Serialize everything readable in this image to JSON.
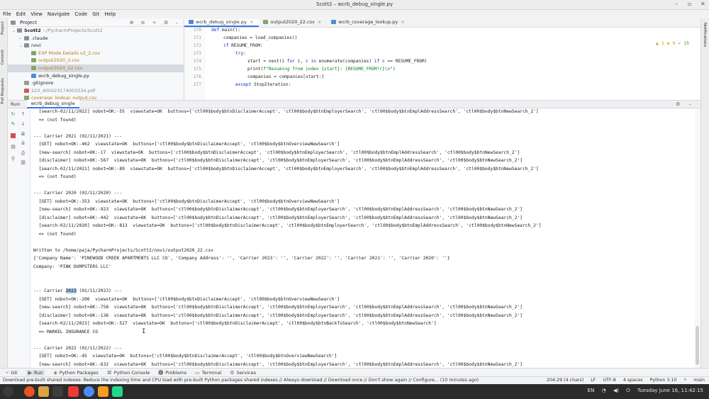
{
  "window": {
    "title": "Scott2 – wcrb_debug_single.py",
    "controls": [
      "–",
      "▫",
      "✕"
    ]
  },
  "menu": [
    "File",
    "Edit",
    "View",
    "Navigate",
    "Code",
    "Git",
    "Help"
  ],
  "left_strip": {
    "labels": [
      "Project",
      "Commit",
      "Pull Requests"
    ]
  },
  "right_strip": {
    "labels": [
      "Notifications"
    ]
  },
  "project": {
    "header": "Project",
    "tools": "⊕ ≡ ÷ ⚙ –",
    "tree": [
      {
        "indent": 0,
        "arrow": "⌄",
        "icon": "fold",
        "name": "Scott2",
        "suffix": " ~/PycharmProjects/Scott2",
        "style": "bold"
      },
      {
        "indent": 1,
        "arrow": "›",
        "icon": "fold",
        "name": ".claude",
        "suffix": "",
        "style": ""
      },
      {
        "indent": 1,
        "arrow": "⌄",
        "icon": "fold",
        "name": "novi",
        "suffix": "",
        "style": ""
      },
      {
        "indent": 2,
        "arrow": "",
        "icon": "csv",
        "name": "EXP Mode Details v2_2.csv",
        "suffix": "",
        "style": "orange"
      },
      {
        "indent": 2,
        "arrow": "",
        "icon": "csv",
        "name": "output2020_2.csv",
        "suffix": "",
        "style": "orange"
      },
      {
        "indent": 2,
        "arrow": "",
        "icon": "csv",
        "name": "output2020_22.csv",
        "suffix": "",
        "style": "orange sel"
      },
      {
        "indent": 2,
        "arrow": "",
        "icon": "py",
        "name": "wcrb_debug_single.py",
        "suffix": "",
        "style": ""
      },
      {
        "indent": 1,
        "arrow": "",
        "icon": "gi",
        "name": ".gitignore",
        "suffix": "",
        "style": ""
      },
      {
        "indent": 1,
        "arrow": "",
        "icon": "pdf",
        "name": "223_400023174003334.pdf",
        "suffix": "",
        "style": "muted"
      },
      {
        "indent": 1,
        "arrow": "",
        "icon": "csv",
        "name": "coverage_lookup_output.csv",
        "suffix": "",
        "style": "orange"
      }
    ]
  },
  "editor": {
    "tabs": [
      {
        "label": "wcrb_debug_single.py",
        "icon": "py",
        "active": true
      },
      {
        "label": "output2020_22.csv",
        "icon": "csv",
        "active": false
      },
      {
        "label": "wcrb_coverage_lookup.py",
        "icon": "py",
        "active": false
      }
    ],
    "inspections": {
      "warnings": "▲ 1",
      "weak": "◈ 9",
      "typos": "✓ 15"
    },
    "lines": [
      {
        "n": "170",
        "indent": 0,
        "html": "<span class='kw'>def</span> main():"
      },
      {
        "n": "171",
        "indent": 1,
        "html": "companies = load_companies()"
      },
      {
        "n": "172",
        "indent": 1,
        "html": "<span class='kw'>if</span> RESUME_FROM:"
      },
      {
        "n": "173",
        "indent": 2,
        "html": "<span class='kw'>try</span>:"
      },
      {
        "n": "174",
        "indent": 3,
        "html": "start = next(i <span class='kw'>for</span> i, c <span class='kw'>in</span> enumerate(companies) <span class='kw'>if</span> c == RESUME_FROM)"
      },
      {
        "n": "175",
        "indent": 3,
        "html": "print(<span class='str'>f\"Resuming from index {start}: {RESUME_FROM!r}\\n\"</span>)"
      },
      {
        "n": "176",
        "indent": 3,
        "html": "companies = companies[start:]"
      },
      {
        "n": "177",
        "indent": 2,
        "html": "<span class='kw'>except</span> StopIteration:"
      }
    ]
  },
  "run": {
    "label": "Run:",
    "tab": "wcrb_debug_single",
    "console": [
      "  [search-02/11/2022] nobot=OK:-55  viewstate=OK  buttons=['ctl00$body$btnDisclaimerAccept', 'ctl00$body$btnEmployerSearch', 'ctl00$body$btnEmplAddressSearch', 'ctl00$body$btnNewSearch_2']",
      "  => (not found)",
      "",
      "--- Carrier 2021 (02/11/2021) ---",
      "  [GET] nobot=OK:-462  viewstate=OK  buttons=['ctl00$body$btnDisclaimerAccept', 'ctl00$body$btnOverviewNewSearch']",
      "  [new-search] nobot=OK:-17  viewstate=OK  buttons=['ctl00$body$btnDisclaimerAccept', 'ctl00$body$btnEmployerSearch', 'ctl00$body$btnEmplAddressSearch', 'ctl00$body$btnNewSearch_2']",
      "  [disclaimer] nobot=OK:-567  viewstate=OK  buttons=['ctl00$body$btnDisclaimerAccept', 'ctl00$body$btnEmployerSearch', 'ctl00$body$btnEmplAddressSearch', 'ctl00$body$btnNewSearch_2']",
      "  [search-02/11/2021] nobot=OK:-89  viewstate=OK  buttons=['ctl00$body$btnDisclaimerAccept', 'ctl00$body$btnEmployerSearch', 'ctl00$body$btnEmplAddressSearch', 'ctl00$body$btnNewSearch_2']",
      "  => (not found)",
      "",
      "--- Carrier 2020 (02/11/2020) ---",
      "  [GET] nobot=OK:-353  viewstate=OK  buttons=['ctl00$body$btnDisclaimerAccept', 'ctl00$body$btnOverviewNewSearch']",
      "  [new-search] nobot=OK:-923  viewstate=OK  buttons=['ctl00$body$btnDisclaimerAccept', 'ctl00$body$btnEmployerSearch', 'ctl00$body$btnEmplAddressSearch', 'ctl00$body$btnNewSearch_2']",
      "  [disclaimer] nobot=OK:-442  viewstate=OK  buttons=['ctl00$body$btnDisclaimerAccept', 'ctl00$body$btnEmployerSearch', 'ctl00$body$btnEmplAddressSearch', 'ctl00$body$btnNewSearch_2']",
      "  [search-02/11/2020] nobot=OK:-813  viewstate=OK  buttons=['ctl00$body$btnDisclaimerAccept', 'ctl00$body$btnEmployerSearch', 'ctl00$body$btnEmplAddressSearch', 'ctl00$body$btnNewSearch_2']",
      "  => (not found)",
      "",
      "Written to /home/paja/PycharmProjects/Scott2/novi/output2020_22.csv",
      "{'Company Name': 'PINEWOOD CREEK APARTMENTS LLC CO', 'Company Address': '', 'Carrier 2023': '', 'Carrier 2022': '', 'Carrier 2021': '', 'Carrier 2020': ''}",
      "Company: 'PINK DUMPSTERS LLC'",
      "",
      "",
      "--- Carrier 2023 (02/11/2023) ---",
      "  [GET] nobot=OK:-206  viewstate=OK  buttons=['ctl00$body$btnDisclaimerAccept', 'ctl00$body$btnOverviewNewSearch']",
      "  [new-search] nobot=OK:-758  viewstate=OK  buttons=['ctl00$body$btnDisclaimerAccept', 'ctl00$body$btnEmployerSearch', 'ctl00$body$btnEmplAddressSearch', 'ctl00$body$btnNewSearch_2']",
      "  [disclaimer] nobot=OK:-136  viewstate=OK  buttons=['ctl00$body$btnDisclaimerAccept', 'ctl00$body$btnEmployerSearch', 'ctl00$body$btnEmplAddressSearch', 'ctl00$body$btnNewSearch_2']",
      "  [search-02/11/2023] nobot=OK:-527  viewstate=OK  buttons=['ctl00$body$btnDisclaimerAccept', 'ctl00$body$btnBackToSearch', 'ctl00$body$btnNewSearch']",
      "  => MARKEL INSURANCE CO",
      "",
      "--- Carrier 2022 (02/11/2022) ---",
      "  [GET] nobot=OK:-45  viewstate=OK  buttons=['ctl00$body$btnDisclaimerAccept', 'ctl00$body$btnOverviewNewSearch']",
      "  [new-search] nobot=OK:-632  viewstate=OK  buttons=['ctl00$body$btnDisclaimerAccept', 'ctl00$body$btnEmployerSearch', 'ctl00$body$btnEmplAddressSearch', 'ctl00$body$btnNewSearch_2']"
    ],
    "selection": {
      "line": 22,
      "text": "2023"
    }
  },
  "tool_windows": [
    {
      "label": "Git",
      "icon": "⑂",
      "active": false
    },
    {
      "label": "Run",
      "icon": "▶",
      "active": true
    },
    {
      "label": "Python Packages",
      "icon": "◈",
      "active": false
    },
    {
      "label": "Python Console",
      "icon": "⌘",
      "active": false
    },
    {
      "label": "Problems",
      "icon": "⓿",
      "active": false
    },
    {
      "label": "Terminal",
      "icon": "▭",
      "active": false
    },
    {
      "label": "Services",
      "icon": "⚙",
      "active": false
    }
  ],
  "status": {
    "message": "Download pre-built shared indexes: Reduce the indexing time and CPU load with pre-built Python packages shared indexes // Always download // Download once // Don't show again // Configure... (10 minutes ago)",
    "position": "204:29 (4 chars)",
    "line_ending": "LF",
    "encoding": "UTF-8",
    "indent": "4 spaces",
    "interpreter": "Python 3.10",
    "branch": "main"
  },
  "taskbar": {
    "language": "EN",
    "datetime": "Tuesday June 16, 11:42:15",
    "apps": [
      {
        "name": "menu-icon",
        "color": "#3a3a3a"
      },
      {
        "name": "ubuntu-icon",
        "color": "#e95420"
      },
      {
        "name": "files-icon",
        "color": "#d9a441"
      },
      {
        "name": "terminal-icon",
        "color": "#3d3d3d"
      },
      {
        "name": "vivaldi-icon",
        "color": "#ef3939"
      },
      {
        "name": "chrome-icon",
        "color": "#4a8df6"
      },
      {
        "name": "sublime-icon",
        "color": "#f59b24"
      },
      {
        "name": "pycharm-icon",
        "color": "#21d789"
      }
    ]
  }
}
